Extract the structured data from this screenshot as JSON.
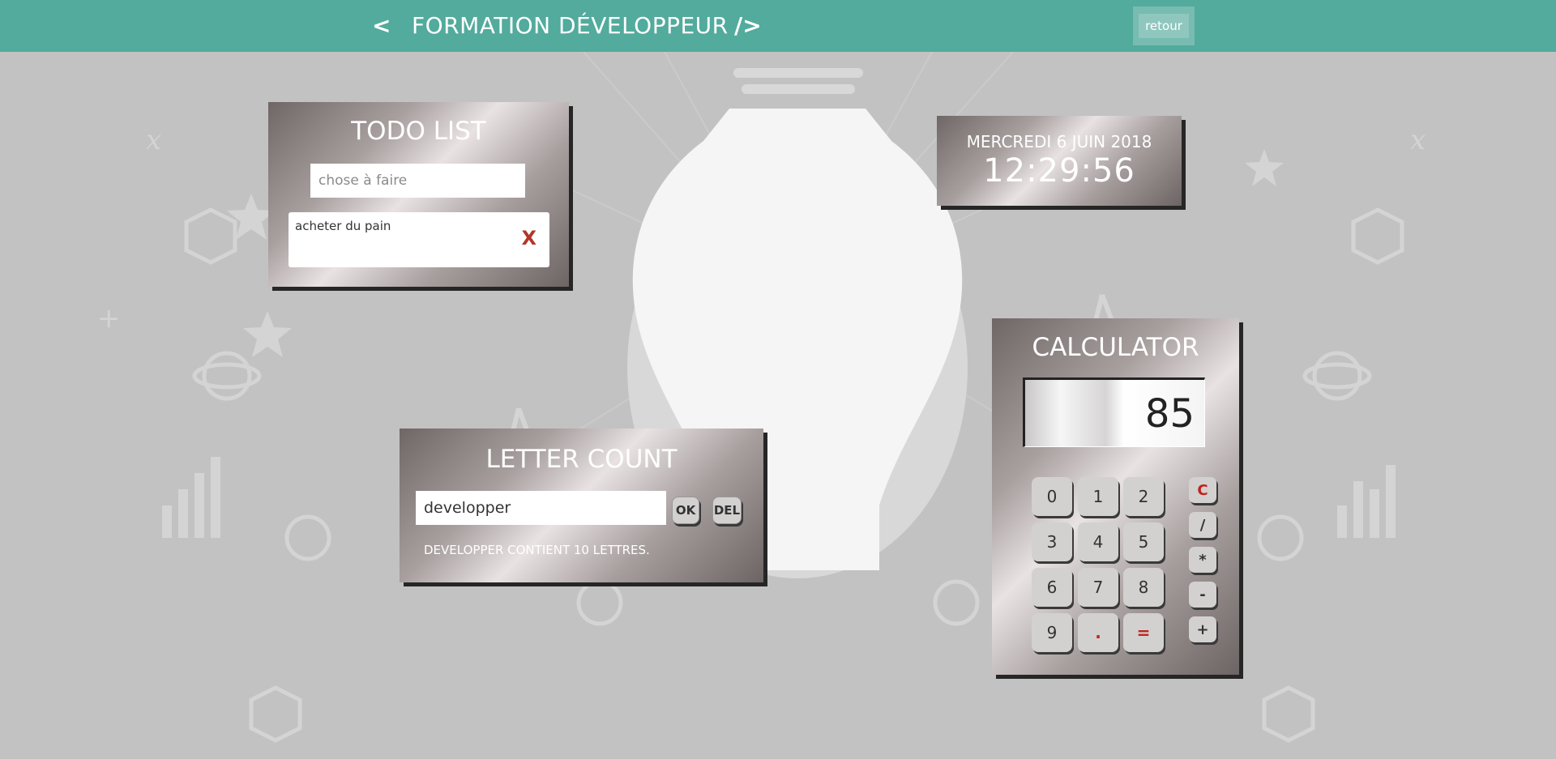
{
  "header": {
    "brand_open": "<",
    "brand_title": "FORMATION DÉVELOPPEUR",
    "brand_close": "/>",
    "back_label": "retour"
  },
  "colors": {
    "header_bg": "#52ab9c",
    "page_bg": "#c2c2c2",
    "accent_red": "#c0241c"
  },
  "todo": {
    "title": "TODO LIST",
    "placeholder": "chose à faire",
    "items": [
      {
        "label": "acheter du pain",
        "delete_label": "X"
      }
    ]
  },
  "clock": {
    "date": "MERCREDI 6 JUIN 2018",
    "time": "12:29:56"
  },
  "letter_count": {
    "title": "LETTER COUNT",
    "input_value": "developper",
    "ok_label": "OK",
    "del_label": "DEL",
    "result": "DEVELOPPER CONTIENT 10 LETTRES."
  },
  "calculator": {
    "title": "CALCULATOR",
    "display": "85",
    "digits": [
      "0",
      "1",
      "2",
      "3",
      "4",
      "5",
      "6",
      "7",
      "8",
      "9",
      ".",
      "="
    ],
    "operators": [
      "C",
      "/",
      "*",
      "-",
      "+"
    ]
  },
  "background": {
    "icons": [
      "lightbulb-icon",
      "atom-icon",
      "compass-icon",
      "molecule-icon",
      "bar-chart-icon",
      "globe-icon",
      "clock-icon",
      "star-icon"
    ]
  }
}
